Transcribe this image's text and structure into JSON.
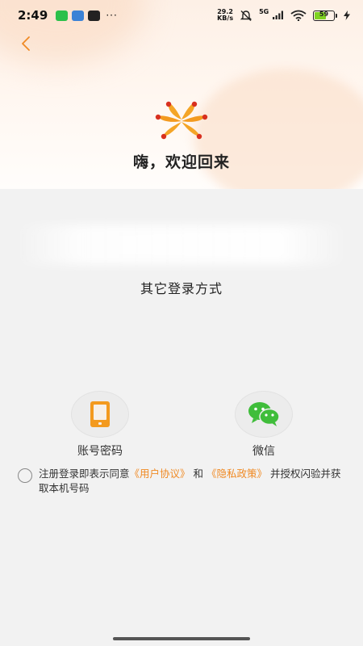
{
  "status_bar": {
    "time": "2:49",
    "more": "···",
    "net_speed_value": "29.2",
    "net_speed_unit": "KB/s",
    "signal_label": "5G",
    "battery_level": "59",
    "battery_fraction": 0.59,
    "battery_color": "#7ed321"
  },
  "header": {
    "back_icon": "chevron-left-icon",
    "logo_icon": "brand-logo-icon",
    "welcome_text": "嗨，欢迎回来"
  },
  "main": {
    "other_login_title": "其它登录方式",
    "options": [
      {
        "label": "账号密码",
        "icon": "phone-icon"
      },
      {
        "label": "微信",
        "icon": "wechat-icon"
      }
    ]
  },
  "agreement": {
    "prefix": "注册登录即表示同意",
    "user_agreement": "《用户协议》",
    "conjunction": "和",
    "privacy_policy": "《隐私政策》",
    "suffix": "并授权闪验并获取本机号码"
  },
  "colors": {
    "accent": "#f08a24",
    "wechat_green": "#3fbd3a"
  }
}
